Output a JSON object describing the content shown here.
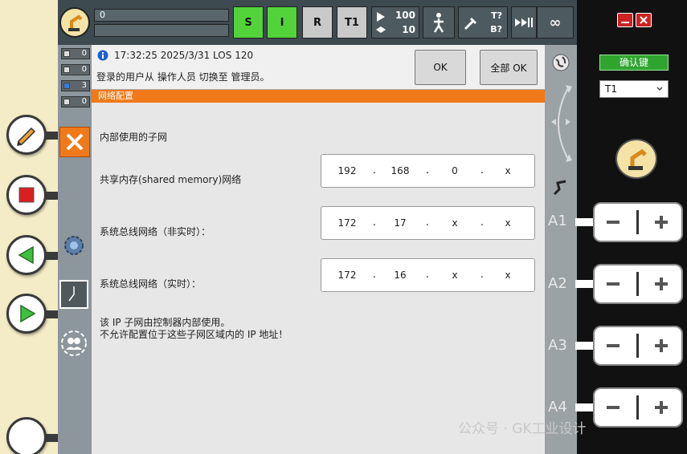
{
  "top_bar": {
    "field_value": "0",
    "mode_s": "S",
    "mode_i": "I",
    "mode_r": "R",
    "mode_t1": "T1",
    "speed_top": "100",
    "speed_bottom": "10",
    "tool_label_t": "T?",
    "tool_label_b": "B?",
    "infinity": "∞"
  },
  "left_strip": {
    "counts": [
      "0",
      "0",
      "3",
      "0"
    ]
  },
  "message": {
    "timestamp": "17:32:25 2025/3/31 LOS 120",
    "text": "登录的用户从 操作人员 切换至 管理员。",
    "ok_label": "OK",
    "all_ok_label": "全部 OK"
  },
  "panel": {
    "header": "网络配置",
    "section_title": "内部使用的子网",
    "rows": [
      {
        "label": "共享内存(shared memory)网络",
        "parts": [
          "192",
          "168",
          "0",
          "x"
        ]
      },
      {
        "label": "系统总线网络（非实时）：",
        "parts": [
          "172",
          "17",
          "x",
          "x"
        ]
      },
      {
        "label": "系统总线网络（实时）：",
        "parts": [
          "172",
          "16",
          "x",
          "x"
        ]
      }
    ],
    "note_line1": "该 IP 子网由控制器内部使用。",
    "note_line2": "不允许配置位于这些子网区域内的 IP 地址！"
  },
  "right_panel": {
    "confirm_label": "确认键",
    "mode_select": "T1",
    "axes": [
      "A1",
      "A2",
      "A3",
      "A4"
    ]
  },
  "watermark": "公众号 · GK工业设计",
  "colors": {
    "accent_orange": "#f07a1a",
    "mode_green": "#53d33a",
    "confirm_green": "#2fa52f",
    "close_red": "#cc2222"
  }
}
